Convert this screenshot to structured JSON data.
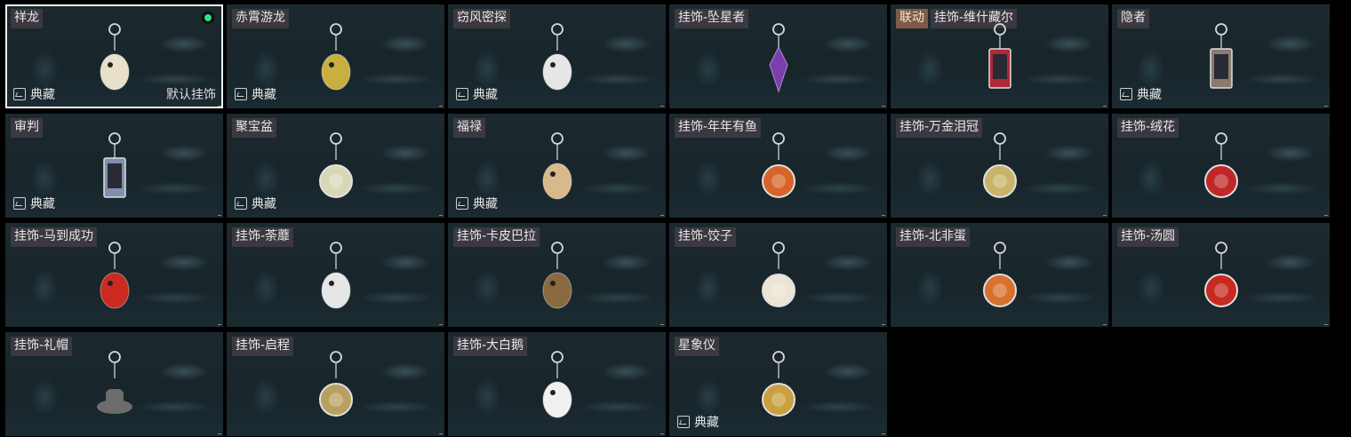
{
  "labels": {
    "collection": "典藏",
    "default": "默认挂饰",
    "collab": "联动"
  },
  "items": [
    {
      "name": "祥龙",
      "collection": true,
      "selected": true,
      "default": true,
      "icon": "dragon-charm-icon",
      "color": "#e8e0c8"
    },
    {
      "name": "赤霄游龙",
      "collection": true,
      "icon": "yellow-dragon-charm-icon",
      "color": "#c8b040"
    },
    {
      "name": "窃风密探",
      "collection": true,
      "icon": "white-rabbit-charm-icon",
      "color": "#e6e6e6"
    },
    {
      "name": "挂饰-坠星者",
      "icon": "purple-crystal-charm-icon",
      "color": "#7a3fa8"
    },
    {
      "name": "挂饰-维什藏尔",
      "collab": true,
      "icon": "red-card-charm-icon",
      "color": "#b0283a"
    },
    {
      "name": "隐者",
      "collection": true,
      "icon": "hermit-card-charm-icon",
      "color": "#8a7a70"
    },
    {
      "name": "审判",
      "collection": true,
      "icon": "judgement-card-charm-icon",
      "color": "#7f8fb0"
    },
    {
      "name": "聚宝盆",
      "collection": true,
      "icon": "treasure-bowl-charm-icon",
      "color": "#d8d8b8"
    },
    {
      "name": "福禄",
      "collection": true,
      "icon": "gourd-charm-icon",
      "color": "#d9b98a"
    },
    {
      "name": "挂饰-年年有鱼",
      "icon": "fish-plate-charm-icon",
      "color": "#d8642a"
    },
    {
      "name": "挂饰-万金泪冠",
      "icon": "gold-crown-charm-icon",
      "color": "#c9b46a"
    },
    {
      "name": "挂饰-绒花",
      "icon": "red-flower-charm-icon",
      "color": "#c02828"
    },
    {
      "name": "挂饰-马到成功",
      "icon": "red-horse-charm-icon",
      "color": "#cc2a20"
    },
    {
      "name": "挂饰-荼蘼",
      "icon": "white-bird-charm-icon",
      "color": "#e6e6e6"
    },
    {
      "name": "挂饰-卡皮巴拉",
      "icon": "capybara-charm-icon",
      "color": "#8a6a40"
    },
    {
      "name": "挂饰-饺子",
      "icon": "dumpling-plate-charm-icon",
      "color": "#ece4d4"
    },
    {
      "name": "挂饰-北非蛋",
      "icon": "shakshuka-pan-charm-icon",
      "color": "#d87030"
    },
    {
      "name": "挂饰-汤圆",
      "icon": "tangyuan-bowl-charm-icon",
      "color": "#c82a20"
    },
    {
      "name": "挂饰-礼帽",
      "icon": "top-hat-charm-icon",
      "color": "#6c6c6c"
    },
    {
      "name": "挂饰-启程",
      "icon": "gold-ring-charm-icon",
      "color": "#b8a060"
    },
    {
      "name": "挂饰-大白鹅",
      "icon": "white-goose-charm-icon",
      "color": "#f0f0f0"
    },
    {
      "name": "星象仪",
      "collection": true,
      "icon": "astrolabe-charm-icon",
      "color": "#c8a040"
    }
  ]
}
